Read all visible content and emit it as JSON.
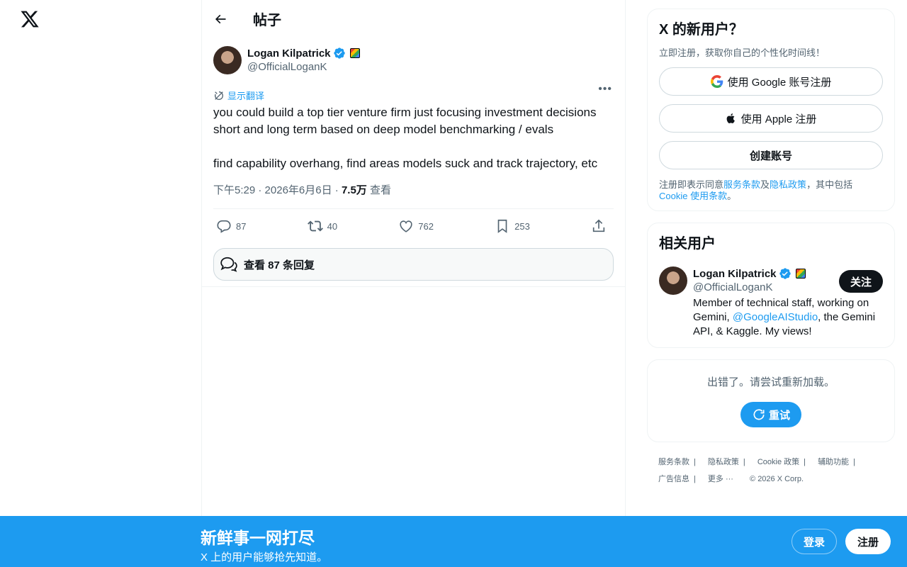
{
  "nav": {
    "logo_icon": "x-logo-icon"
  },
  "header": {
    "title": "帖子",
    "back_icon": "arrow-left-icon"
  },
  "tweet": {
    "author": {
      "name": "Logan Kilpatrick",
      "handle": "@OfficialLoganK"
    },
    "translate_label": "显示翻译",
    "text": "you could build a top tier venture firm just focusing investment decisions short and long term based on deep model benchmarking / evals\n\nfind capability overhang, find areas models suck and track trajectory, etc",
    "time": "下午5:29",
    "date": "2026年6月6日",
    "views": "7.5万",
    "views_label": "查看",
    "stats": {
      "replies": "87",
      "retweets": "40",
      "likes": "762",
      "bookmarks": "253"
    },
    "view_replies_label": "查看 87 条回复"
  },
  "signup_card": {
    "title": "X 的新用户？",
    "subtitle": "立即注册，获取你自己的个性化时间线！",
    "google_label": "使用 Google 账号注册",
    "apple_label": "使用 Apple 注册",
    "create_label": "创建账号",
    "terms_prefix": "注册即表示同意",
    "terms_link": "服务条款",
    "terms_and": "及",
    "privacy_link": "隐私政策",
    "terms_mid": "，其中包括 ",
    "cookie_link": "Cookie 使用条款",
    "terms_end": "。"
  },
  "related": {
    "title": "相关用户",
    "user": {
      "name": "Logan Kilpatrick",
      "handle": "@OfficialLoganK",
      "follow_label": "关注",
      "bio_1": "Member of technical staff, working on Gemini, ",
      "bio_link": "@GoogleAIStudio",
      "bio_2": ", the Gemini API, & Kaggle. My views!"
    }
  },
  "error_card": {
    "message": "出错了。请尝试重新加载。",
    "retry_label": "重试"
  },
  "footer": {
    "links": [
      "服务条款",
      "隐私政策",
      "Cookie 政策",
      "辅助功能",
      "广告信息",
      "更多 ···"
    ],
    "copyright": "© 2026 X Corp."
  },
  "bottom_bar": {
    "title": "新鲜事一网打尽",
    "subtitle": "X 上的用户能够抢先知道。",
    "login_label": "登录",
    "signup_label": "注册"
  },
  "colors": {
    "accent": "#1d9bf0",
    "text": "#0f1419",
    "muted": "#536471"
  }
}
